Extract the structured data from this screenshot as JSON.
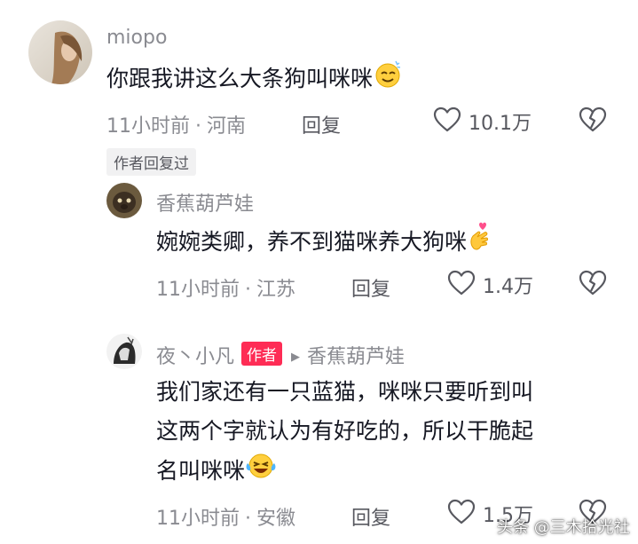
{
  "comments": [
    {
      "username": "miopo",
      "text": "你跟我讲这么大条狗叫咪咪",
      "emoji": "smile-sweat-emoji",
      "time": "11小时前",
      "location": "河南",
      "reply_label": "回复",
      "likes": "10.1万",
      "author_replied_badge": "作者回复过"
    }
  ],
  "replies": [
    {
      "username": "香蕉葫芦娃",
      "text": "婉婉类卿，养不到猫咪养大狗咪",
      "emoji": "finger-heart-emoji",
      "time": "11小时前",
      "location": "江苏",
      "reply_label": "回复",
      "likes": "1.4万"
    },
    {
      "username": "夜丶小凡",
      "author_tag": "作者",
      "reply_to": "香蕉葫芦娃",
      "text_lines": [
        "我们家还有一只蓝猫，咪咪只要听到叫",
        "这两个字就认为有好吃的，所以干脆起",
        "名叫咪咪"
      ],
      "emoji": "laughing-tears-emoji",
      "time": "11小时前",
      "location": "安徽",
      "reply_label": "回复",
      "likes": "1.5万"
    }
  ],
  "meta_separator": "·",
  "watermark": "头条 @三木拾光社",
  "colors": {
    "text": "#161823",
    "secondary": "#8a8b91",
    "accent": "#fe2c55",
    "badge_bg": "#f1f1f2"
  }
}
